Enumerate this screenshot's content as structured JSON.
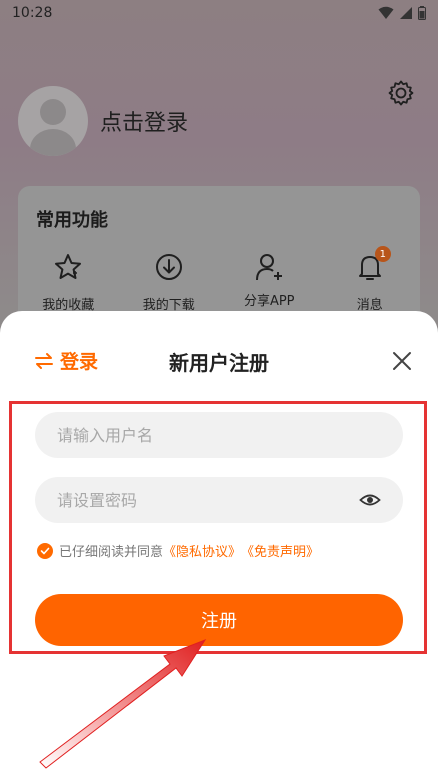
{
  "status_bar": {
    "time": "10:28"
  },
  "profile": {
    "login_prompt": "点击登录"
  },
  "common_functions": {
    "title": "常用功能",
    "items": [
      {
        "label": "我的收藏",
        "icon": "star-icon"
      },
      {
        "label": "我的下载",
        "icon": "download-icon"
      },
      {
        "label": "分享APP",
        "icon": "add-user-icon"
      },
      {
        "label": "消息",
        "icon": "bell-icon",
        "badge": "1"
      }
    ]
  },
  "sheet": {
    "switch_label": "登录",
    "title": "新用户注册",
    "username_placeholder": "请输入用户名",
    "password_placeholder": "请设置密码",
    "agreement_text": "已仔细阅读并同意",
    "privacy_link": "《隐私协议》",
    "disclaimer_link": "《免责声明》",
    "register_label": "注册"
  },
  "colors": {
    "accent": "#ff6400",
    "annotation": "#e53333"
  }
}
